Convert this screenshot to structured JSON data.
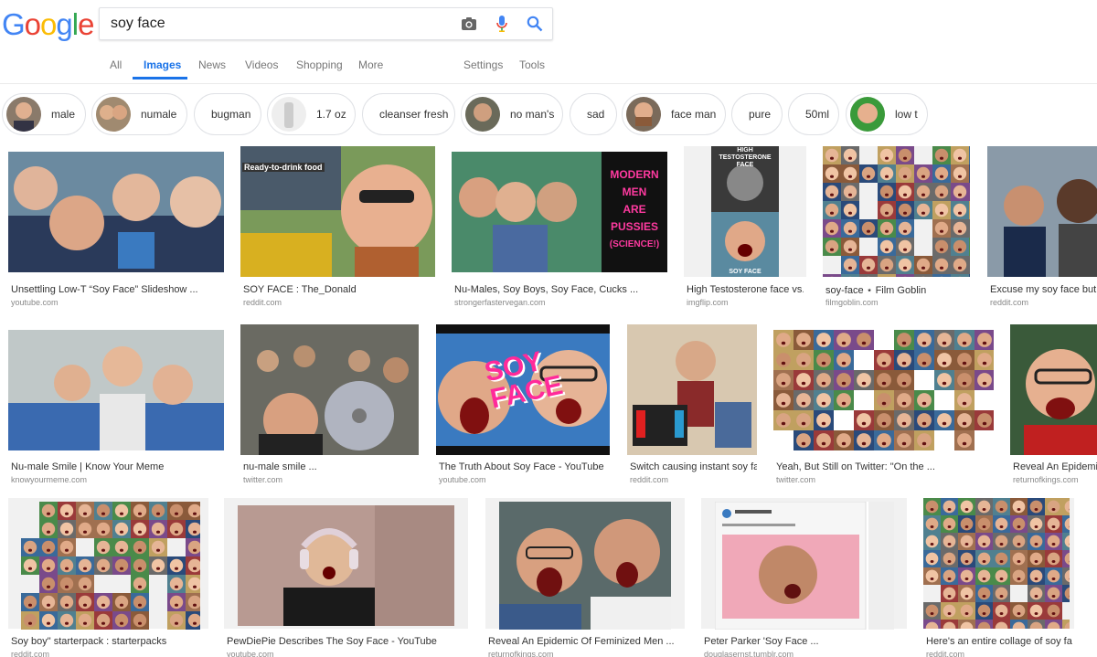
{
  "search": {
    "query": "soy face"
  },
  "logo": {
    "letters": [
      "G",
      "o",
      "o",
      "g",
      "l",
      "e"
    ],
    "colors": [
      "#4285f4",
      "#ea4335",
      "#fbbc05",
      "#4285f4",
      "#34a853",
      "#ea4335"
    ]
  },
  "tabs": {
    "all": "All",
    "images": "Images",
    "news": "News",
    "videos": "Videos",
    "shopping": "Shopping",
    "more": "More",
    "settings": "Settings",
    "tools": "Tools"
  },
  "accent_color": "#1a73e8",
  "chips": [
    {
      "label": "male",
      "thumb": true
    },
    {
      "label": "numale",
      "thumb": true
    },
    {
      "label": "bugman",
      "thumb": false
    },
    {
      "label": "1.7 oz",
      "thumb": true
    },
    {
      "label": "cleanser fresh",
      "thumb": false
    },
    {
      "label": "no man's",
      "thumb": true
    },
    {
      "label": "sad",
      "thumb": false
    },
    {
      "label": "face man",
      "thumb": true
    },
    {
      "label": "pure",
      "thumb": false
    },
    {
      "label": "50ml",
      "thumb": false
    },
    {
      "label": "low t",
      "thumb": true
    }
  ],
  "results": [
    {
      "caption": "Unsettling Low-T “Soy Face” Slideshow ...",
      "source": "youtube.com"
    },
    {
      "caption": "SOY FACE : The_Donald",
      "source": "reddit.com",
      "overlay": "Ready-to-drink food"
    },
    {
      "caption": "Nu-Males, Soy Boys, Soy Face, Cucks ...",
      "source": "strongerfastervegan.com",
      "overlay_lines": [
        "MODERN",
        "MEN",
        "ARE",
        "PUSSIES",
        "(SCIENCE!)"
      ]
    },
    {
      "caption": "High Testosterone face vs. ...",
      "source": "imgflip.com",
      "overlay_top": "HIGH TESTOSTERONE FACE",
      "overlay_bottom": "SOY FACE"
    },
    {
      "caption": "soy-face ⋆ Film Goblin",
      "source": "filmgoblin.com"
    },
    {
      "caption": "Excuse my soy face but I f...",
      "source": "reddit.com"
    },
    {
      "caption": "Nu-male Smile | Know Your Meme",
      "source": "knowyourmeme.com"
    },
    {
      "caption": "nu-male smile ...",
      "source": "twitter.com"
    },
    {
      "caption": "The Truth About Soy Face - YouTube",
      "source": "youtube.com",
      "overlay_lines": [
        "SOY",
        "FACE"
      ]
    },
    {
      "caption": "Switch causing instant soy fa...",
      "source": "reddit.com"
    },
    {
      "caption": "Yeah, But Still on Twitter: \"On the ...",
      "source": "twitter.com"
    },
    {
      "caption": "Reveal An Epidemic",
      "source": "returnofkings.com"
    },
    {
      "caption": "Soy boy\" starterpack : starterpacks",
      "source": "reddit.com"
    },
    {
      "caption": "PewDiePie Describes The Soy Face - YouTube",
      "source": "youtube.com"
    },
    {
      "caption": "Reveal An Epidemic Of Feminized Men ...",
      "source": "returnofkings.com"
    },
    {
      "caption": "Peter Parker 'Soy Face ...",
      "source": "douglasernst.tumblr.com"
    },
    {
      "caption": "Here's an entire collage of soy fac...",
      "source": "reddit.com"
    }
  ]
}
